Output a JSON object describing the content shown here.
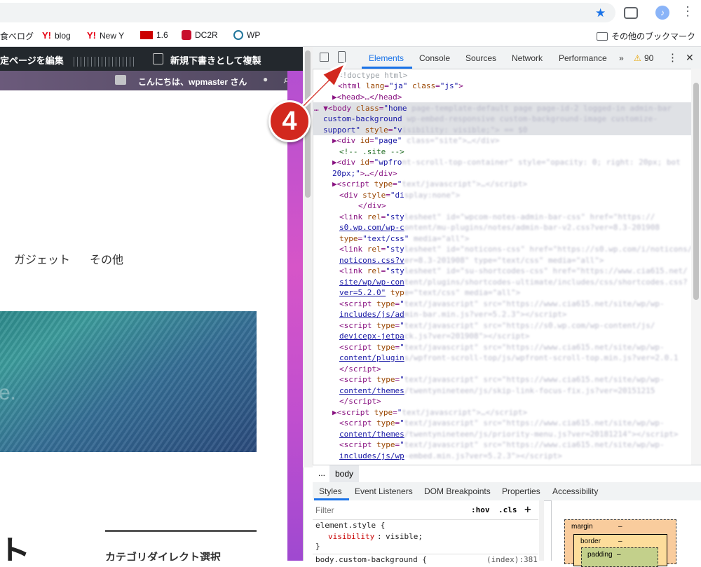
{
  "browser": {
    "bookmarks": [
      "食べログ",
      "blog",
      "New Y",
      "1.6",
      "DC2R",
      "WP"
    ],
    "other_bookmarks": "その他のブックマーク"
  },
  "wp": {
    "edit_page": "定ページを編集",
    "new_draft": "新規下書きとして複製",
    "greeting": "こんにちは、wpmaster さん",
    "nav_gadget": "ガジェット",
    "nav_other": "その他",
    "heading_fragment": "ト",
    "sidebar_heading": "カテゴリダイレクト選択",
    "image_text": "e."
  },
  "devtools": {
    "tabs": [
      "Elements",
      "Console",
      "Sources",
      "Network",
      "Performance"
    ],
    "more": "»",
    "warning_count": "90",
    "breadcrumb": "body",
    "breadcrumb_more": "...",
    "subtabs": [
      "Styles",
      "Event Listeners",
      "DOM Breakpoints",
      "Properties",
      "Accessibility"
    ],
    "filter_placeholder": "Filter",
    "hov": ":hov",
    "cls": ".cls",
    "add": "+",
    "style_rule1": "element.style {",
    "style_prop": "visibility",
    "style_val": "visible;",
    "style_close": "}",
    "style_rule2": "body.custom-background {",
    "style_source": "(index):381",
    "box_margin": "margin",
    "box_border": "border",
    "box_padding": "padding",
    "box_dash": "–"
  },
  "annotation": {
    "step": "4"
  },
  "colors": {
    "accent": "#1a73e8",
    "badge": "#d2281e"
  }
}
